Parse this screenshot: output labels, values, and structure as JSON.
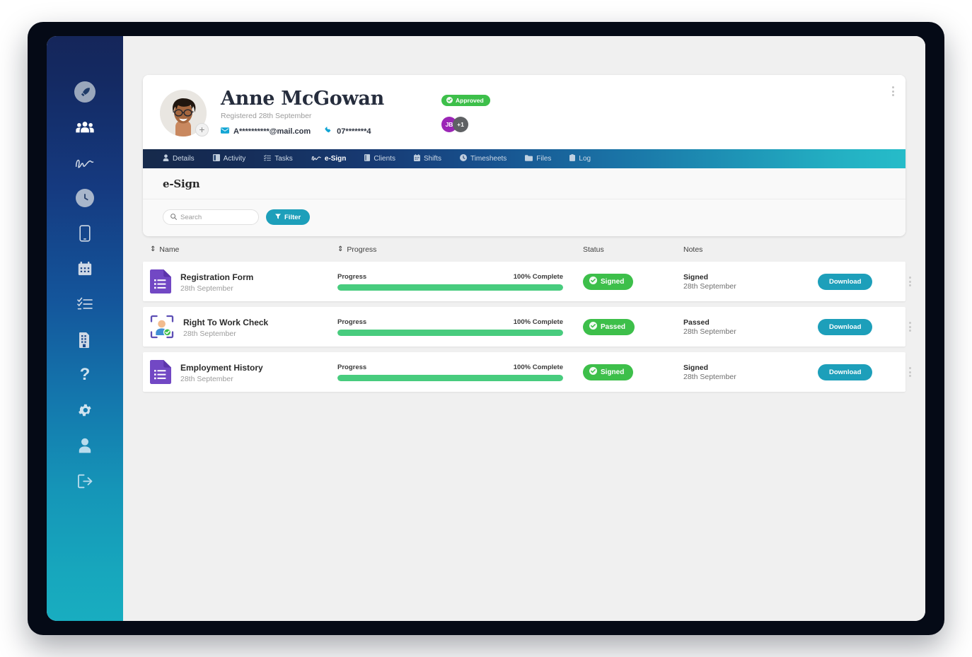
{
  "sidebar": {
    "items": [
      {
        "icon": "rocket-logo-icon",
        "label": "Dashboard"
      },
      {
        "icon": "people-group-icon",
        "label": "People"
      },
      {
        "icon": "signature-icon",
        "label": "e-Sign"
      },
      {
        "icon": "clock-icon",
        "label": "Time"
      },
      {
        "icon": "mobile-phone-icon",
        "label": "Mobile"
      },
      {
        "icon": "calendar-icon",
        "label": "Calendar"
      },
      {
        "icon": "checklist-icon",
        "label": "Tasks"
      },
      {
        "icon": "building-icon",
        "label": "Clients"
      },
      {
        "icon": "question-mark-icon",
        "label": "Help"
      },
      {
        "icon": "gear-icon",
        "label": "Settings"
      },
      {
        "icon": "user-icon",
        "label": "Account"
      },
      {
        "icon": "logout-icon",
        "label": "Log out"
      }
    ]
  },
  "profile": {
    "name": "Anne McGowan",
    "registered": "Registered 28th September",
    "email": "A**********@mail.com",
    "phone": "07*******4",
    "status_badge": "Approved",
    "assignees": [
      {
        "initials": "JB",
        "color": "#9b26b6"
      },
      {
        "initials": "+1",
        "color": "#5f6164"
      }
    ],
    "avatar_add_label": "+"
  },
  "tabs": [
    {
      "label": "Details",
      "icon": "person-icon",
      "active": false
    },
    {
      "label": "Activity",
      "icon": "activity-icon",
      "active": false
    },
    {
      "label": "Tasks",
      "icon": "checklist-icon",
      "active": false
    },
    {
      "label": "e-Sign",
      "icon": "signature-icon",
      "active": true
    },
    {
      "label": "Clients",
      "icon": "book-icon",
      "active": false
    },
    {
      "label": "Shifts",
      "icon": "calendar-icon",
      "active": false
    },
    {
      "label": "Timesheets",
      "icon": "clock-icon",
      "active": false
    },
    {
      "label": "Files",
      "icon": "folder-icon",
      "active": false
    },
    {
      "label": "Log",
      "icon": "clipboard-icon",
      "active": false
    }
  ],
  "section": {
    "title": "e-Sign"
  },
  "toolbar": {
    "search_placeholder": "Search",
    "search_value": "",
    "filter_label": "Filter"
  },
  "table": {
    "headers": {
      "name": "Name",
      "progress": "Progress",
      "status": "Status",
      "notes": "Notes"
    },
    "rows": [
      {
        "icon": "form-document-icon",
        "title": "Registration Form",
        "date": "28th September",
        "progress_label": "Progress",
        "progress_text": "100% Complete",
        "progress_value": 100,
        "status": "Signed",
        "note_title": "Signed",
        "note_date": "28th September",
        "action_label": "Download"
      },
      {
        "icon": "right-to-work-icon",
        "title": "Right To Work Check",
        "date": "28th September",
        "progress_label": "Progress",
        "progress_text": "100% Complete",
        "progress_value": 100,
        "status": "Passed",
        "note_title": "Passed",
        "note_date": "28th September",
        "action_label": "Download"
      },
      {
        "icon": "form-document-icon",
        "title": "Employment History",
        "date": "28th September",
        "progress_label": "Progress",
        "progress_text": "100% Complete",
        "progress_value": 100,
        "status": "Signed",
        "note_title": "Signed",
        "note_date": "28th September",
        "action_label": "Download"
      }
    ]
  },
  "colors": {
    "accent_teal": "#1d9fba",
    "status_green": "#3dbf4a",
    "progress_green": "#48cc7e",
    "doc_purple": "#7248c4",
    "assignee_purple": "#9b26b6",
    "sidebar_top": "#15265a",
    "sidebar_bottom": "#18adc0"
  }
}
